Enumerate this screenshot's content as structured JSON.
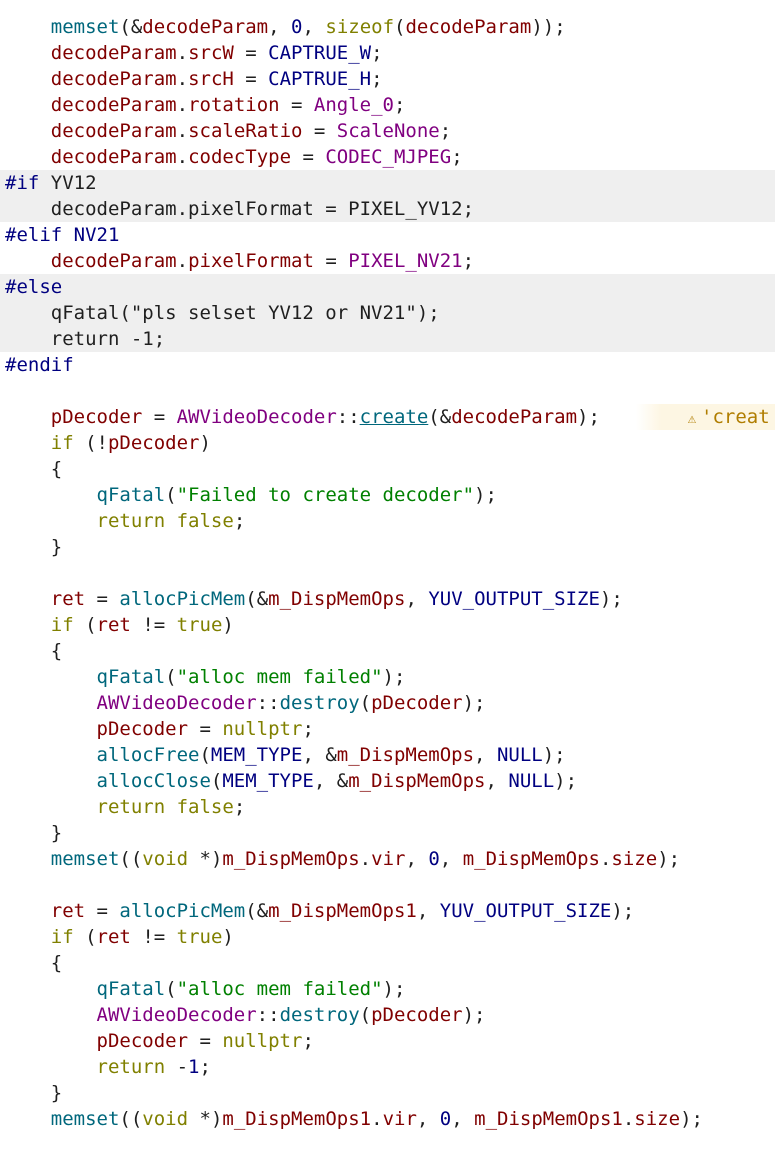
{
  "code_lines": [
    {
      "indent": 1,
      "tokens": [
        {
          "c": "fn",
          "t": "memset"
        },
        {
          "c": "plain",
          "t": "(&"
        },
        {
          "c": "mem",
          "t": "decodeParam"
        },
        {
          "c": "plain",
          "t": ", "
        },
        {
          "c": "num",
          "t": "0"
        },
        {
          "c": "plain",
          "t": ", "
        },
        {
          "c": "kw",
          "t": "sizeof"
        },
        {
          "c": "plain",
          "t": "("
        },
        {
          "c": "mem",
          "t": "decodeParam"
        },
        {
          "c": "plain",
          "t": "));"
        }
      ]
    },
    {
      "indent": 1,
      "tokens": [
        {
          "c": "mem",
          "t": "decodeParam"
        },
        {
          "c": "plain",
          "t": "."
        },
        {
          "c": "mem",
          "t": "srcW"
        },
        {
          "c": "plain",
          "t": " = "
        },
        {
          "c": "macro",
          "t": "CAPTRUE_W"
        },
        {
          "c": "plain",
          "t": ";"
        }
      ]
    },
    {
      "indent": 1,
      "tokens": [
        {
          "c": "mem",
          "t": "decodeParam"
        },
        {
          "c": "plain",
          "t": "."
        },
        {
          "c": "mem",
          "t": "srcH"
        },
        {
          "c": "plain",
          "t": " = "
        },
        {
          "c": "macro",
          "t": "CAPTRUE_H"
        },
        {
          "c": "plain",
          "t": ";"
        }
      ]
    },
    {
      "indent": 1,
      "tokens": [
        {
          "c": "mem",
          "t": "decodeParam"
        },
        {
          "c": "plain",
          "t": "."
        },
        {
          "c": "mem",
          "t": "rotation"
        },
        {
          "c": "plain",
          "t": " = "
        },
        {
          "c": "enum",
          "t": "Angle_0"
        },
        {
          "c": "plain",
          "t": ";"
        }
      ]
    },
    {
      "indent": 1,
      "tokens": [
        {
          "c": "mem",
          "t": "decodeParam"
        },
        {
          "c": "plain",
          "t": "."
        },
        {
          "c": "mem",
          "t": "scaleRatio"
        },
        {
          "c": "plain",
          "t": " = "
        },
        {
          "c": "enum",
          "t": "ScaleNone"
        },
        {
          "c": "plain",
          "t": ";"
        }
      ]
    },
    {
      "indent": 1,
      "tokens": [
        {
          "c": "mem",
          "t": "decodeParam"
        },
        {
          "c": "plain",
          "t": "."
        },
        {
          "c": "mem",
          "t": "codecType"
        },
        {
          "c": "plain",
          "t": " = "
        },
        {
          "c": "enum",
          "t": "CODEC_MJPEG"
        },
        {
          "c": "plain",
          "t": ";"
        }
      ]
    },
    {
      "indent": 0,
      "inactive": true,
      "tokens": [
        {
          "c": "pp",
          "t": "#if"
        },
        {
          "c": "plain",
          "t": " YV12"
        }
      ]
    },
    {
      "indent": 1,
      "inactive": true,
      "tokens": [
        {
          "c": "plain",
          "t": "decodeParam.pixelFormat = PIXEL_YV12;"
        }
      ]
    },
    {
      "indent": 0,
      "tokens": [
        {
          "c": "pp",
          "t": "#elif"
        },
        {
          "c": "plain",
          "t": " "
        },
        {
          "c": "macro",
          "t": "NV21"
        }
      ]
    },
    {
      "indent": 1,
      "tokens": [
        {
          "c": "mem",
          "t": "decodeParam"
        },
        {
          "c": "plain",
          "t": "."
        },
        {
          "c": "mem",
          "t": "pixelFormat"
        },
        {
          "c": "plain",
          "t": " = "
        },
        {
          "c": "enum",
          "t": "PIXEL_NV21"
        },
        {
          "c": "plain",
          "t": ";"
        }
      ]
    },
    {
      "indent": 0,
      "inactive": true,
      "tokens": [
        {
          "c": "pp",
          "t": "#else"
        }
      ]
    },
    {
      "indent": 1,
      "inactive": true,
      "tokens": [
        {
          "c": "plain",
          "t": "qFatal(\"pls selset YV12 or NV21\");"
        }
      ]
    },
    {
      "indent": 1,
      "inactive": true,
      "tokens": [
        {
          "c": "plain",
          "t": "return -1;"
        }
      ]
    },
    {
      "indent": 0,
      "tokens": [
        {
          "c": "pp",
          "t": "#endif"
        }
      ]
    },
    {
      "indent": 0,
      "tokens": []
    },
    {
      "indent": 1,
      "warning": true,
      "tokens": [
        {
          "c": "mem",
          "t": "pDecoder"
        },
        {
          "c": "plain",
          "t": " = "
        },
        {
          "c": "cls",
          "t": "AWVideoDecoder"
        },
        {
          "c": "plain",
          "t": "::"
        },
        {
          "c": "link",
          "t": "create"
        },
        {
          "c": "plain",
          "t": "(&"
        },
        {
          "c": "mem",
          "t": "decodeParam"
        },
        {
          "c": "plain",
          "t": ");"
        }
      ]
    },
    {
      "indent": 1,
      "tokens": [
        {
          "c": "kw",
          "t": "if"
        },
        {
          "c": "plain",
          "t": " (!"
        },
        {
          "c": "mem",
          "t": "pDecoder"
        },
        {
          "c": "plain",
          "t": ")"
        }
      ]
    },
    {
      "indent": 1,
      "tokens": [
        {
          "c": "plain",
          "t": "{"
        }
      ]
    },
    {
      "indent": 2,
      "tokens": [
        {
          "c": "fn",
          "t": "qFatal"
        },
        {
          "c": "plain",
          "t": "("
        },
        {
          "c": "str",
          "t": "\"Failed to create decoder\""
        },
        {
          "c": "plain",
          "t": ");"
        }
      ]
    },
    {
      "indent": 2,
      "tokens": [
        {
          "c": "kw",
          "t": "return"
        },
        {
          "c": "plain",
          "t": " "
        },
        {
          "c": "kw",
          "t": "false"
        },
        {
          "c": "plain",
          "t": ";"
        }
      ]
    },
    {
      "indent": 1,
      "tokens": [
        {
          "c": "plain",
          "t": "}"
        }
      ]
    },
    {
      "indent": 0,
      "tokens": []
    },
    {
      "indent": 1,
      "tokens": [
        {
          "c": "mem",
          "t": "ret"
        },
        {
          "c": "plain",
          "t": " = "
        },
        {
          "c": "fn",
          "t": "allocPicMem"
        },
        {
          "c": "plain",
          "t": "(&"
        },
        {
          "c": "mem",
          "t": "m_DispMemOps"
        },
        {
          "c": "plain",
          "t": ", "
        },
        {
          "c": "macro",
          "t": "YUV_OUTPUT_SIZE"
        },
        {
          "c": "plain",
          "t": ");"
        }
      ]
    },
    {
      "indent": 1,
      "tokens": [
        {
          "c": "kw",
          "t": "if"
        },
        {
          "c": "plain",
          "t": " ("
        },
        {
          "c": "mem",
          "t": "ret"
        },
        {
          "c": "plain",
          "t": " != "
        },
        {
          "c": "kw",
          "t": "true"
        },
        {
          "c": "plain",
          "t": ")"
        }
      ]
    },
    {
      "indent": 1,
      "tokens": [
        {
          "c": "plain",
          "t": "{"
        }
      ]
    },
    {
      "indent": 2,
      "tokens": [
        {
          "c": "fn",
          "t": "qFatal"
        },
        {
          "c": "plain",
          "t": "("
        },
        {
          "c": "str",
          "t": "\"alloc mem failed\""
        },
        {
          "c": "plain",
          "t": ");"
        }
      ]
    },
    {
      "indent": 2,
      "tokens": [
        {
          "c": "cls",
          "t": "AWVideoDecoder"
        },
        {
          "c": "plain",
          "t": "::"
        },
        {
          "c": "fn",
          "t": "destroy"
        },
        {
          "c": "plain",
          "t": "("
        },
        {
          "c": "mem",
          "t": "pDecoder"
        },
        {
          "c": "plain",
          "t": ");"
        }
      ]
    },
    {
      "indent": 2,
      "tokens": [
        {
          "c": "mem",
          "t": "pDecoder"
        },
        {
          "c": "plain",
          "t": " = "
        },
        {
          "c": "kw",
          "t": "nullptr"
        },
        {
          "c": "plain",
          "t": ";"
        }
      ]
    },
    {
      "indent": 2,
      "tokens": [
        {
          "c": "fn",
          "t": "allocFree"
        },
        {
          "c": "plain",
          "t": "("
        },
        {
          "c": "macro",
          "t": "MEM_TYPE"
        },
        {
          "c": "plain",
          "t": ", &"
        },
        {
          "c": "mem",
          "t": "m_DispMemOps"
        },
        {
          "c": "plain",
          "t": ", "
        },
        {
          "c": "macro",
          "t": "NULL"
        },
        {
          "c": "plain",
          "t": ");"
        }
      ]
    },
    {
      "indent": 2,
      "tokens": [
        {
          "c": "fn",
          "t": "allocClose"
        },
        {
          "c": "plain",
          "t": "("
        },
        {
          "c": "macro",
          "t": "MEM_TYPE"
        },
        {
          "c": "plain",
          "t": ", &"
        },
        {
          "c": "mem",
          "t": "m_DispMemOps"
        },
        {
          "c": "plain",
          "t": ", "
        },
        {
          "c": "macro",
          "t": "NULL"
        },
        {
          "c": "plain",
          "t": ");"
        }
      ]
    },
    {
      "indent": 2,
      "tokens": [
        {
          "c": "kw",
          "t": "return"
        },
        {
          "c": "plain",
          "t": " "
        },
        {
          "c": "kw",
          "t": "false"
        },
        {
          "c": "plain",
          "t": ";"
        }
      ]
    },
    {
      "indent": 1,
      "tokens": [
        {
          "c": "plain",
          "t": "}"
        }
      ]
    },
    {
      "indent": 1,
      "tokens": [
        {
          "c": "fn",
          "t": "memset"
        },
        {
          "c": "plain",
          "t": "(("
        },
        {
          "c": "kw",
          "t": "void"
        },
        {
          "c": "plain",
          "t": " *)"
        },
        {
          "c": "mem",
          "t": "m_DispMemOps"
        },
        {
          "c": "plain",
          "t": "."
        },
        {
          "c": "mem",
          "t": "vir"
        },
        {
          "c": "plain",
          "t": ", "
        },
        {
          "c": "num",
          "t": "0"
        },
        {
          "c": "plain",
          "t": ", "
        },
        {
          "c": "mem",
          "t": "m_DispMemOps"
        },
        {
          "c": "plain",
          "t": "."
        },
        {
          "c": "mem",
          "t": "size"
        },
        {
          "c": "plain",
          "t": ");"
        }
      ]
    },
    {
      "indent": 0,
      "tokens": []
    },
    {
      "indent": 1,
      "tokens": [
        {
          "c": "mem",
          "t": "ret"
        },
        {
          "c": "plain",
          "t": " = "
        },
        {
          "c": "fn",
          "t": "allocPicMem"
        },
        {
          "c": "plain",
          "t": "(&"
        },
        {
          "c": "mem",
          "t": "m_DispMemOps1"
        },
        {
          "c": "plain",
          "t": ", "
        },
        {
          "c": "macro",
          "t": "YUV_OUTPUT_SIZE"
        },
        {
          "c": "plain",
          "t": ");"
        }
      ]
    },
    {
      "indent": 1,
      "tokens": [
        {
          "c": "kw",
          "t": "if"
        },
        {
          "c": "plain",
          "t": " ("
        },
        {
          "c": "mem",
          "t": "ret"
        },
        {
          "c": "plain",
          "t": " != "
        },
        {
          "c": "kw",
          "t": "true"
        },
        {
          "c": "plain",
          "t": ")"
        }
      ]
    },
    {
      "indent": 1,
      "tokens": [
        {
          "c": "plain",
          "t": "{"
        }
      ]
    },
    {
      "indent": 2,
      "tokens": [
        {
          "c": "fn",
          "t": "qFatal"
        },
        {
          "c": "plain",
          "t": "("
        },
        {
          "c": "str",
          "t": "\"alloc mem failed\""
        },
        {
          "c": "plain",
          "t": ");"
        }
      ]
    },
    {
      "indent": 2,
      "tokens": [
        {
          "c": "cls",
          "t": "AWVideoDecoder"
        },
        {
          "c": "plain",
          "t": "::"
        },
        {
          "c": "fn",
          "t": "destroy"
        },
        {
          "c": "plain",
          "t": "("
        },
        {
          "c": "mem",
          "t": "pDecoder"
        },
        {
          "c": "plain",
          "t": ");"
        }
      ]
    },
    {
      "indent": 2,
      "tokens": [
        {
          "c": "mem",
          "t": "pDecoder"
        },
        {
          "c": "plain",
          "t": " = "
        },
        {
          "c": "kw",
          "t": "nullptr"
        },
        {
          "c": "plain",
          "t": ";"
        }
      ]
    },
    {
      "indent": 2,
      "tokens": [
        {
          "c": "kw",
          "t": "return"
        },
        {
          "c": "plain",
          "t": " -"
        },
        {
          "c": "num",
          "t": "1"
        },
        {
          "c": "plain",
          "t": ";"
        }
      ]
    },
    {
      "indent": 1,
      "tokens": [
        {
          "c": "plain",
          "t": "}"
        }
      ]
    },
    {
      "indent": 1,
      "tokens": [
        {
          "c": "fn",
          "t": "memset"
        },
        {
          "c": "plain",
          "t": "(("
        },
        {
          "c": "kw",
          "t": "void"
        },
        {
          "c": "plain",
          "t": " *)"
        },
        {
          "c": "mem",
          "t": "m_DispMemOps1"
        },
        {
          "c": "plain",
          "t": "."
        },
        {
          "c": "mem",
          "t": "vir"
        },
        {
          "c": "plain",
          "t": ", "
        },
        {
          "c": "num",
          "t": "0"
        },
        {
          "c": "plain",
          "t": ", "
        },
        {
          "c": "mem",
          "t": "m_DispMemOps1"
        },
        {
          "c": "plain",
          "t": "."
        },
        {
          "c": "mem",
          "t": "size"
        },
        {
          "c": "plain",
          "t": ");"
        }
      ]
    }
  ],
  "inline_warning": {
    "icon": "warning-triangle-icon",
    "glyph": "⚠",
    "text": "'creat"
  },
  "colors": {
    "background": "#ffffff",
    "inactive_block": "#efefef",
    "function": "#00677c",
    "member": "#800000",
    "keyword": "#808000",
    "string": "#008000",
    "enum": "#800080",
    "macro": "#000080",
    "warning": "#b07d00"
  }
}
